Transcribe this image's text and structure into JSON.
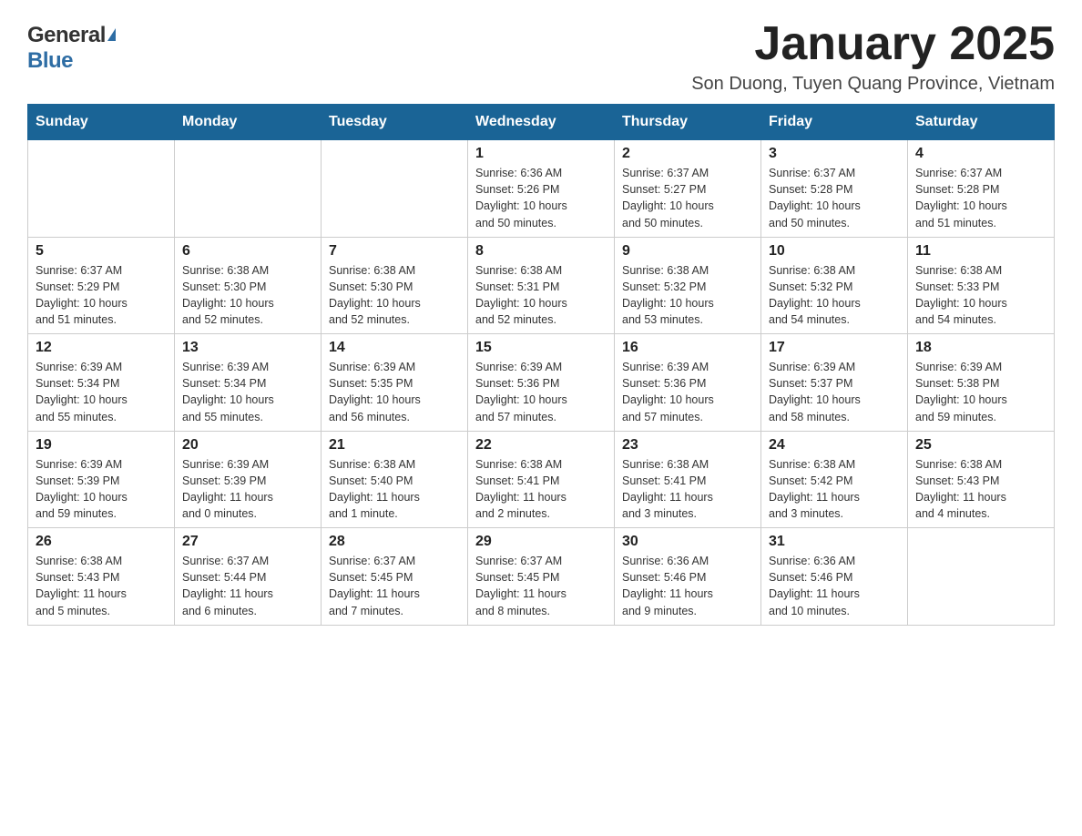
{
  "header": {
    "logo": {
      "general": "General",
      "blue": "Blue",
      "tagline": "GeneralBlue"
    },
    "title": "January 2025",
    "location": "Son Duong, Tuyen Quang Province, Vietnam"
  },
  "weekdays": [
    "Sunday",
    "Monday",
    "Tuesday",
    "Wednesday",
    "Thursday",
    "Friday",
    "Saturday"
  ],
  "weeks": [
    [
      {
        "day": "",
        "info": ""
      },
      {
        "day": "",
        "info": ""
      },
      {
        "day": "",
        "info": ""
      },
      {
        "day": "1",
        "info": "Sunrise: 6:36 AM\nSunset: 5:26 PM\nDaylight: 10 hours\nand 50 minutes."
      },
      {
        "day": "2",
        "info": "Sunrise: 6:37 AM\nSunset: 5:27 PM\nDaylight: 10 hours\nand 50 minutes."
      },
      {
        "day": "3",
        "info": "Sunrise: 6:37 AM\nSunset: 5:28 PM\nDaylight: 10 hours\nand 50 minutes."
      },
      {
        "day": "4",
        "info": "Sunrise: 6:37 AM\nSunset: 5:28 PM\nDaylight: 10 hours\nand 51 minutes."
      }
    ],
    [
      {
        "day": "5",
        "info": "Sunrise: 6:37 AM\nSunset: 5:29 PM\nDaylight: 10 hours\nand 51 minutes."
      },
      {
        "day": "6",
        "info": "Sunrise: 6:38 AM\nSunset: 5:30 PM\nDaylight: 10 hours\nand 52 minutes."
      },
      {
        "day": "7",
        "info": "Sunrise: 6:38 AM\nSunset: 5:30 PM\nDaylight: 10 hours\nand 52 minutes."
      },
      {
        "day": "8",
        "info": "Sunrise: 6:38 AM\nSunset: 5:31 PM\nDaylight: 10 hours\nand 52 minutes."
      },
      {
        "day": "9",
        "info": "Sunrise: 6:38 AM\nSunset: 5:32 PM\nDaylight: 10 hours\nand 53 minutes."
      },
      {
        "day": "10",
        "info": "Sunrise: 6:38 AM\nSunset: 5:32 PM\nDaylight: 10 hours\nand 54 minutes."
      },
      {
        "day": "11",
        "info": "Sunrise: 6:38 AM\nSunset: 5:33 PM\nDaylight: 10 hours\nand 54 minutes."
      }
    ],
    [
      {
        "day": "12",
        "info": "Sunrise: 6:39 AM\nSunset: 5:34 PM\nDaylight: 10 hours\nand 55 minutes."
      },
      {
        "day": "13",
        "info": "Sunrise: 6:39 AM\nSunset: 5:34 PM\nDaylight: 10 hours\nand 55 minutes."
      },
      {
        "day": "14",
        "info": "Sunrise: 6:39 AM\nSunset: 5:35 PM\nDaylight: 10 hours\nand 56 minutes."
      },
      {
        "day": "15",
        "info": "Sunrise: 6:39 AM\nSunset: 5:36 PM\nDaylight: 10 hours\nand 57 minutes."
      },
      {
        "day": "16",
        "info": "Sunrise: 6:39 AM\nSunset: 5:36 PM\nDaylight: 10 hours\nand 57 minutes."
      },
      {
        "day": "17",
        "info": "Sunrise: 6:39 AM\nSunset: 5:37 PM\nDaylight: 10 hours\nand 58 minutes."
      },
      {
        "day": "18",
        "info": "Sunrise: 6:39 AM\nSunset: 5:38 PM\nDaylight: 10 hours\nand 59 minutes."
      }
    ],
    [
      {
        "day": "19",
        "info": "Sunrise: 6:39 AM\nSunset: 5:39 PM\nDaylight: 10 hours\nand 59 minutes."
      },
      {
        "day": "20",
        "info": "Sunrise: 6:39 AM\nSunset: 5:39 PM\nDaylight: 11 hours\nand 0 minutes."
      },
      {
        "day": "21",
        "info": "Sunrise: 6:38 AM\nSunset: 5:40 PM\nDaylight: 11 hours\nand 1 minute."
      },
      {
        "day": "22",
        "info": "Sunrise: 6:38 AM\nSunset: 5:41 PM\nDaylight: 11 hours\nand 2 minutes."
      },
      {
        "day": "23",
        "info": "Sunrise: 6:38 AM\nSunset: 5:41 PM\nDaylight: 11 hours\nand 3 minutes."
      },
      {
        "day": "24",
        "info": "Sunrise: 6:38 AM\nSunset: 5:42 PM\nDaylight: 11 hours\nand 3 minutes."
      },
      {
        "day": "25",
        "info": "Sunrise: 6:38 AM\nSunset: 5:43 PM\nDaylight: 11 hours\nand 4 minutes."
      }
    ],
    [
      {
        "day": "26",
        "info": "Sunrise: 6:38 AM\nSunset: 5:43 PM\nDaylight: 11 hours\nand 5 minutes."
      },
      {
        "day": "27",
        "info": "Sunrise: 6:37 AM\nSunset: 5:44 PM\nDaylight: 11 hours\nand 6 minutes."
      },
      {
        "day": "28",
        "info": "Sunrise: 6:37 AM\nSunset: 5:45 PM\nDaylight: 11 hours\nand 7 minutes."
      },
      {
        "day": "29",
        "info": "Sunrise: 6:37 AM\nSunset: 5:45 PM\nDaylight: 11 hours\nand 8 minutes."
      },
      {
        "day": "30",
        "info": "Sunrise: 6:36 AM\nSunset: 5:46 PM\nDaylight: 11 hours\nand 9 minutes."
      },
      {
        "day": "31",
        "info": "Sunrise: 6:36 AM\nSunset: 5:46 PM\nDaylight: 11 hours\nand 10 minutes."
      },
      {
        "day": "",
        "info": ""
      }
    ]
  ]
}
